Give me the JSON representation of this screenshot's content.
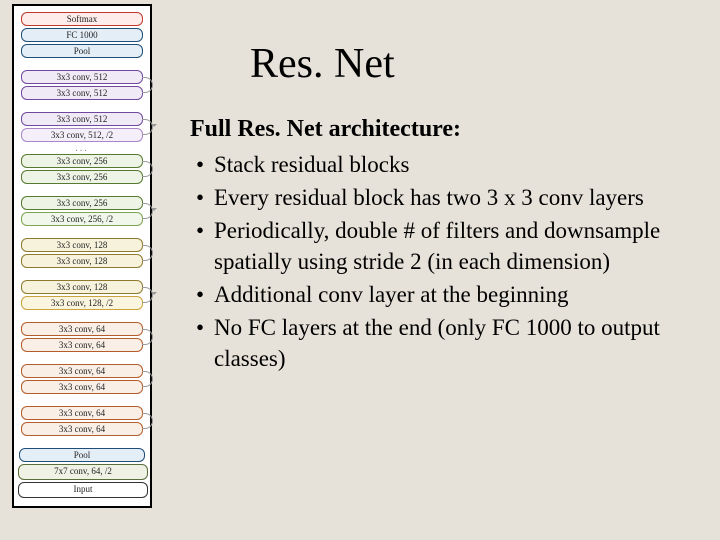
{
  "title": "Res. Net",
  "subhead": "Full Res. Net architecture:",
  "bullets": [
    "Stack residual blocks",
    "Every residual block has two 3 x 3 conv layers",
    "Periodically, double # of filters and downsample spatially using stride 2 (in each dimension)",
    "Additional conv layer at the beginning",
    "No FC layers at the end (only FC 1000 to output classes)"
  ],
  "layers": {
    "softmax": "Softmax",
    "fc1000": "FC 1000",
    "pool": "Pool",
    "c64": "3x3 conv, 64",
    "c128": "3x3 conv, 128",
    "c128s": "3x3 conv, 128, /2",
    "c256": "3x3 conv, 256",
    "c256s": "3x3 conv, 256, /2",
    "c512": "3x3 conv, 512",
    "c512s": "3x3 conv, 512, /2",
    "conv7": "7x7 conv, 64, /2",
    "input": "Input"
  },
  "dots": "..."
}
